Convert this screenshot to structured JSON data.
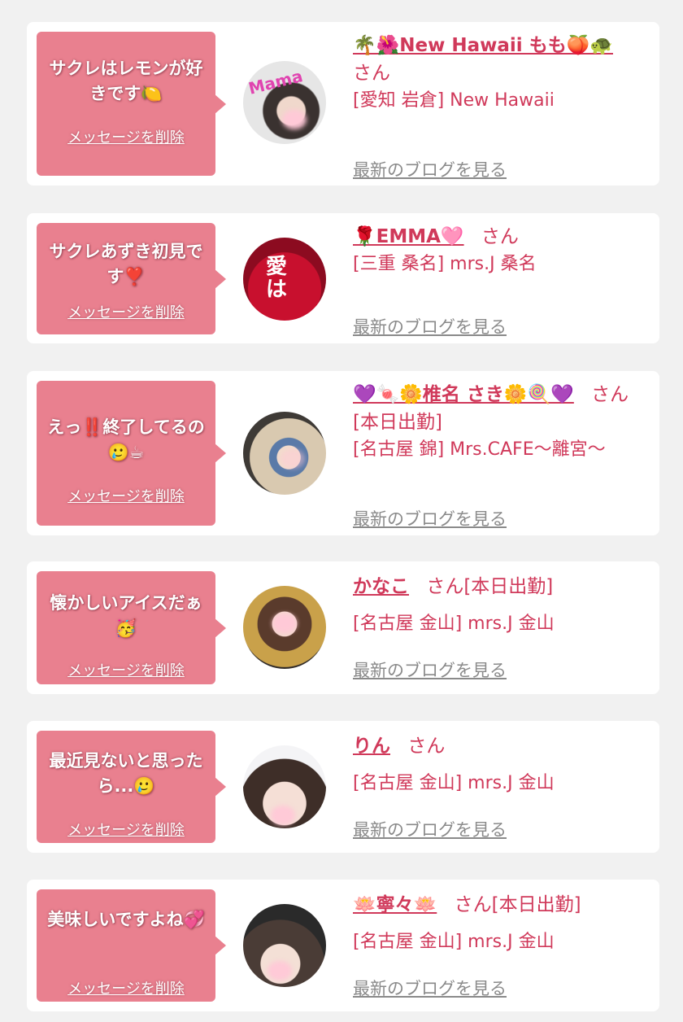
{
  "messages": [
    {
      "comment": "サクレはレモンが好きです🍋",
      "delete_label": "メッセージを削除",
      "name": "🌴🌺New Hawaii もも🍑🐢",
      "san": "さん",
      "status": "",
      "location": "[愛知 岩倉] New Hawaii",
      "blog_label": "最新のブログを見る",
      "avatar_icon": "profile-photo"
    },
    {
      "comment": "サクレあずき初見です❣️",
      "delete_label": "メッセージを削除",
      "name": "🌹EMMA🩷",
      "san": "さん",
      "status": "",
      "location": "[三重 桑名] mrs.J 桑名",
      "blog_label": "最新のブログを見る",
      "avatar_icon": "profile-photo"
    },
    {
      "comment": "えっ‼️終了してるの🥲☕",
      "delete_label": "メッセージを削除",
      "name": "💜🍬🌼椎名 さき🌼🍭💜",
      "san": "さん",
      "status": "[本日出勤]",
      "location": "[名古屋 錦] Mrs.CAFE〜離宮〜",
      "blog_label": "最新のブログを見る",
      "avatar_icon": "profile-photo"
    },
    {
      "comment": "懐かしいアイスだぁ🥳",
      "delete_label": "メッセージを削除",
      "name": "かなこ",
      "san": "さん",
      "status": "[本日出勤]",
      "location": "[名古屋 金山] mrs.J 金山",
      "blog_label": "最新のブログを見る",
      "avatar_icon": "profile-photo"
    },
    {
      "comment": "最近見ないと思ったら...🥲",
      "delete_label": "メッセージを削除",
      "name": "りん",
      "san": "さん",
      "status": "",
      "location": "[名古屋 金山] mrs.J 金山",
      "blog_label": "最新のブログを見る",
      "avatar_icon": "profile-photo"
    },
    {
      "comment": "美味しいですよね💞",
      "delete_label": "メッセージを削除",
      "name": "🪷寧々🪷",
      "san": "さん",
      "status": "[本日出勤]",
      "location": "[名古屋 金山] mrs.J 金山",
      "blog_label": "最新のブログを見る",
      "avatar_icon": "profile-photo"
    }
  ],
  "colors": {
    "bubble": "#e9808f",
    "accent_text": "#d0395a",
    "link_gray": "#8a8a8a",
    "page_bg": "#f1f1f1"
  }
}
